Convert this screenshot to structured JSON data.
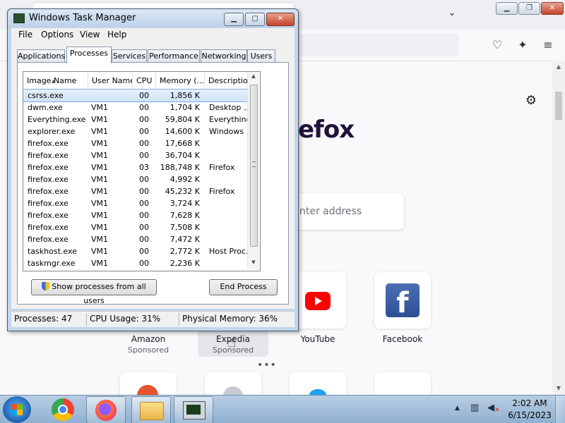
{
  "taskmgr": {
    "title": "Windows Task Manager",
    "menu": [
      "File",
      "Options",
      "View",
      "Help"
    ],
    "tabs": [
      "Applications",
      "Processes",
      "Services",
      "Performance",
      "Networking",
      "Users"
    ],
    "active_tab": "Processes",
    "columns": [
      "Image Name",
      "User Name",
      "CPU",
      "Memory (...",
      "Description"
    ],
    "processes": [
      {
        "name": "csrss.exe",
        "user": "",
        "cpu": "00",
        "mem": "1,856 K",
        "desc": "",
        "selected": true
      },
      {
        "name": "dwm.exe",
        "user": "VM1",
        "cpu": "00",
        "mem": "1,704 K",
        "desc": "Desktop ..."
      },
      {
        "name": "Everything.exe",
        "user": "VM1",
        "cpu": "00",
        "mem": "59,804 K",
        "desc": "Everything"
      },
      {
        "name": "explorer.exe",
        "user": "VM1",
        "cpu": "00",
        "mem": "14,600 K",
        "desc": "Windows ..."
      },
      {
        "name": "firefox.exe",
        "user": "VM1",
        "cpu": "00",
        "mem": "17,668 K",
        "desc": ""
      },
      {
        "name": "firefox.exe",
        "user": "VM1",
        "cpu": "00",
        "mem": "36,704 K",
        "desc": ""
      },
      {
        "name": "firefox.exe",
        "user": "VM1",
        "cpu": "03",
        "mem": "188,748 K",
        "desc": "Firefox"
      },
      {
        "name": "firefox.exe",
        "user": "VM1",
        "cpu": "00",
        "mem": "4,992 K",
        "desc": ""
      },
      {
        "name": "firefox.exe",
        "user": "VM1",
        "cpu": "00",
        "mem": "45,232 K",
        "desc": "Firefox"
      },
      {
        "name": "firefox.exe",
        "user": "VM1",
        "cpu": "00",
        "mem": "3,724 K",
        "desc": ""
      },
      {
        "name": "firefox.exe",
        "user": "VM1",
        "cpu": "00",
        "mem": "7,628 K",
        "desc": ""
      },
      {
        "name": "firefox.exe",
        "user": "VM1",
        "cpu": "00",
        "mem": "7,508 K",
        "desc": ""
      },
      {
        "name": "firefox.exe",
        "user": "VM1",
        "cpu": "00",
        "mem": "7,472 K",
        "desc": ""
      },
      {
        "name": "taskhost.exe",
        "user": "VM1",
        "cpu": "00",
        "mem": "2,772 K",
        "desc": "Host Proc..."
      },
      {
        "name": "taskmgr.exe",
        "user": "VM1",
        "cpu": "00",
        "mem": "2,236 K",
        "desc": ""
      }
    ],
    "show_all_label": "Show processes from all users",
    "end_process_label": "End Process",
    "status": {
      "processes": "Processes: 47",
      "cpu": "CPU Usage: 31%",
      "memory": "Physical Memory: 36%"
    }
  },
  "firefox": {
    "brand_fragment": "efox",
    "search_placeholder": "nter address",
    "shortcuts": [
      {
        "label": "Amazon",
        "sub": "Sponsored"
      },
      {
        "label": "Expedia",
        "sub": "Sponsored"
      },
      {
        "label": "YouTube",
        "sub": ""
      },
      {
        "label": "Facebook",
        "sub": ""
      }
    ],
    "more_dots": "•••"
  },
  "taskbar": {
    "time": "2:02 AM",
    "date": "6/15/2023"
  },
  "colors": {
    "selection": "#cfe2f7",
    "titlebar": "#bcd1e8",
    "taskbar": "#8fb0d0",
    "youtube": "#ff0000",
    "facebook": "#3b5998"
  }
}
